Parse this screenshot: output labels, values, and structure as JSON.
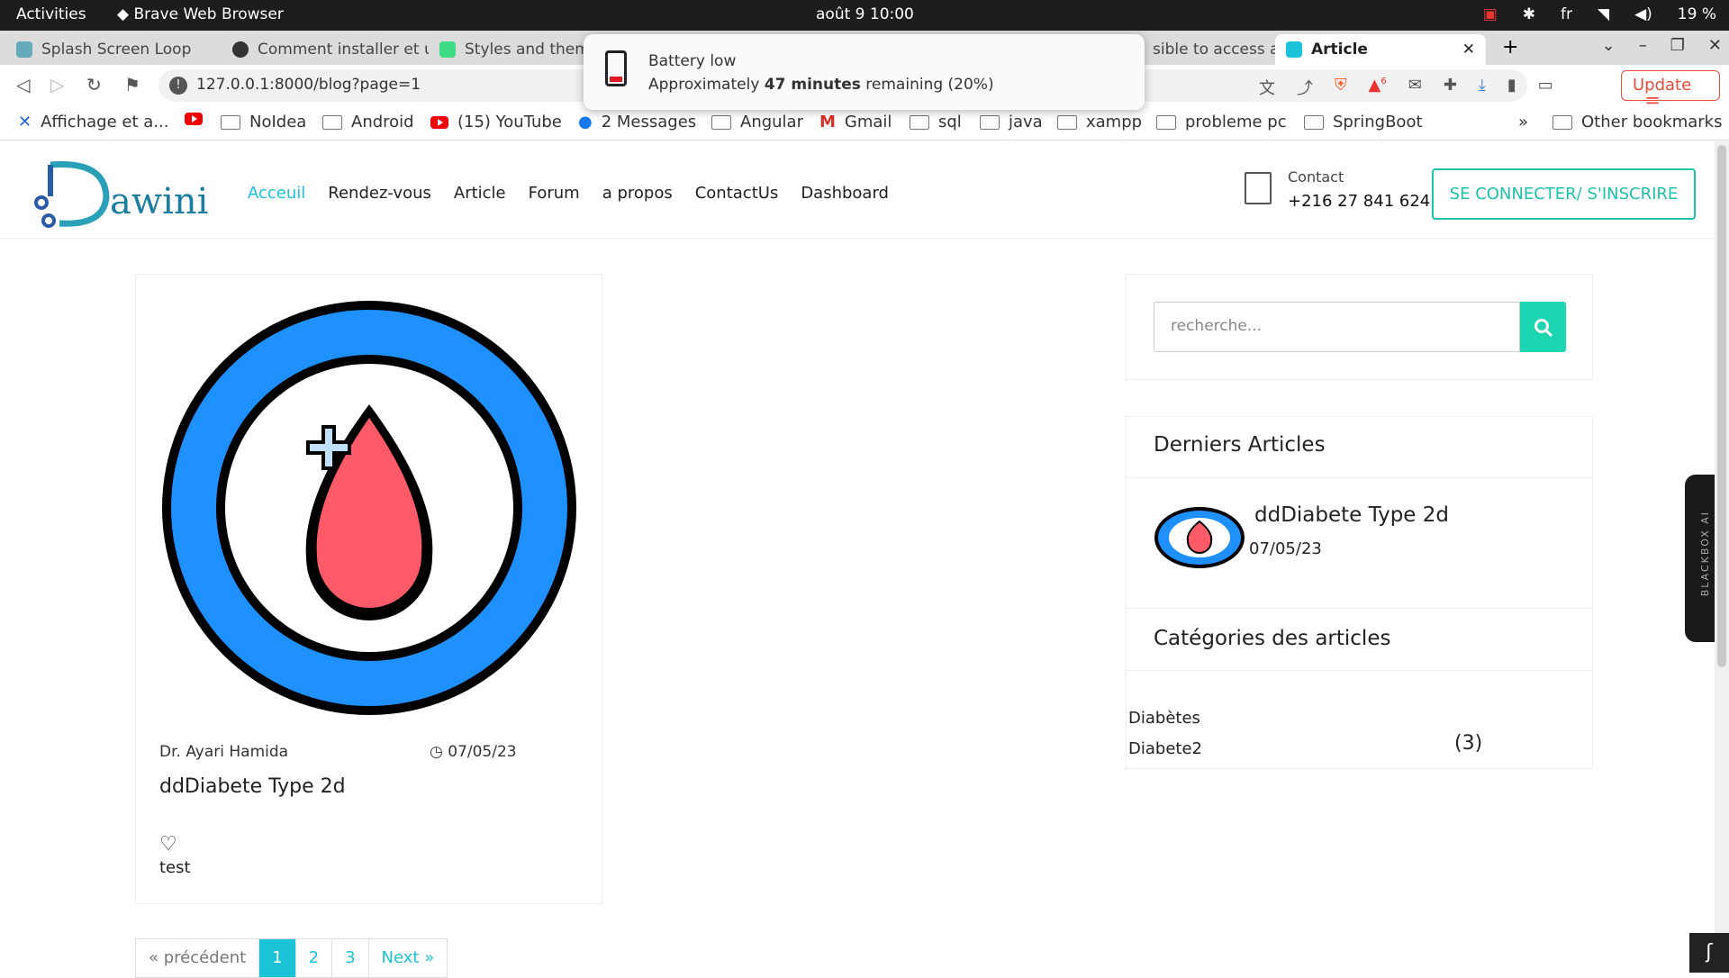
{
  "system_bar": {
    "activities": "Activities",
    "app": "Brave Web Browser",
    "clock": "août 9  10:00",
    "lang": "fr",
    "battery": "19 %"
  },
  "tabs": [
    {
      "label": "Splash Screen Loop"
    },
    {
      "label": "Comment installer et u"
    },
    {
      "label": "Styles and them"
    },
    {
      "label": "sible to access a"
    },
    {
      "label": "Article"
    }
  ],
  "toolbar": {
    "url": "127.0.0.1:8000/blog?page=1",
    "update_label": "Update",
    "brave_badge": "6"
  },
  "bookmarks": [
    {
      "label": "Affichage et a..."
    },
    {
      "label": "NoIdea"
    },
    {
      "label": "Android"
    },
    {
      "label": "(15) YouTube"
    },
    {
      "label": "2 Messages"
    },
    {
      "label": "Angular"
    },
    {
      "label": "Gmail"
    },
    {
      "label": "sql"
    },
    {
      "label": "java"
    },
    {
      "label": "xampp"
    },
    {
      "label": "probleme pc"
    },
    {
      "label": "SpringBoot"
    }
  ],
  "bookmarks_more": "»",
  "bookmarks_other": "Other bookmarks",
  "notification": {
    "title": "Battery low",
    "prefix": "Approximately",
    "minutes": "47 minutes",
    "suffix": "remaining (20%)"
  },
  "site": {
    "logo": "awini",
    "nav": [
      "Acceuil",
      "Rendez-vous",
      "Article",
      "Forum",
      "a propos",
      "ContactUs",
      "Dashboard"
    ],
    "contact_label": "Contact",
    "contact_phone": "+216 27 841 624",
    "login_label": "SE CONNECTER/ S'INSCRIRE"
  },
  "post": {
    "author": "Dr. Ayari Hamida",
    "date": "07/05/23",
    "title": "ddDiabete Type 2d",
    "text": "test"
  },
  "pagination": {
    "prev": "« précédent",
    "pages": [
      "1",
      "2",
      "3"
    ],
    "next": "Next »"
  },
  "sidebar": {
    "search_placeholder": "recherche...",
    "latest_title": "Derniers Articles",
    "latest_article": {
      "title": "ddDiabete Type 2d",
      "date": "07/05/23"
    },
    "categories_title": "Catégories des articles",
    "categories": [
      {
        "name": "Diabètes"
      },
      {
        "name": "Diabete2"
      }
    ],
    "category_count": "(3)"
  },
  "blackbox_label": "BLACKBOX AI",
  "colors": {
    "accent": "#1bc3d8",
    "search_button": "#1bd6b0",
    "drop_red": "#ff5a67",
    "ring_blue": "#1e90ff"
  }
}
